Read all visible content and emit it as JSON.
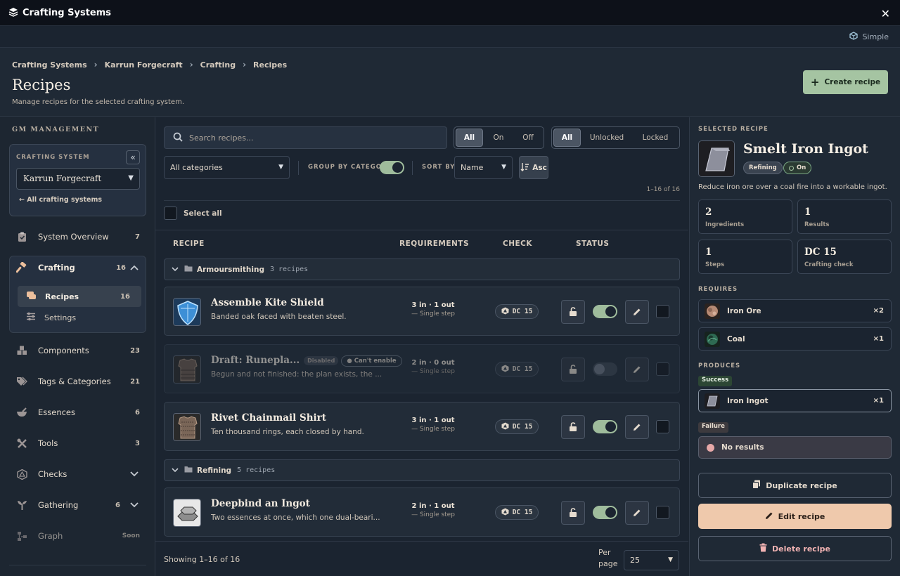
{
  "window": {
    "title": "Crafting Systems",
    "close_label": "✕",
    "mode_label": "Simple"
  },
  "breadcrumb": [
    "Crafting Systems",
    "Karrun Forgecraft",
    "Crafting",
    "Recipes"
  ],
  "page": {
    "title": "Recipes",
    "subtitle": "Manage recipes for the selected crafting system.",
    "create_label": "Create recipe"
  },
  "sidebar": {
    "heading": "GM MANAGEMENT",
    "system_label": "CRAFTING SYSTEM",
    "system_value": "Karrun Forgecraft",
    "back_label": "All crafting systems",
    "items": [
      {
        "label": "System Overview",
        "count": "7"
      },
      {
        "label": "Crafting",
        "count": "16"
      },
      {
        "label": "Components",
        "count": "23"
      },
      {
        "label": "Tags & Categories",
        "count": "21"
      },
      {
        "label": "Essences",
        "count": "6"
      },
      {
        "label": "Tools",
        "count": "3"
      },
      {
        "label": "Checks",
        "count": ""
      },
      {
        "label": "Gathering",
        "count": "6"
      },
      {
        "label": "Graph",
        "count": "Soon"
      }
    ],
    "subitems": [
      {
        "label": "Recipes",
        "count": "16"
      },
      {
        "label": "Settings",
        "count": ""
      }
    ]
  },
  "filters": {
    "search_placeholder": "Search recipes...",
    "state_options": [
      "All",
      "On",
      "Off"
    ],
    "lock_options": [
      "All",
      "Unlocked",
      "Locked"
    ],
    "category_value": "All categories",
    "group_label": "GROUP BY CATEGORY",
    "sort_label": "SORT BY",
    "sort_value": "Name",
    "order_label": "Asc",
    "range_text": "1–16 of 16",
    "select_all": "Select all"
  },
  "table": {
    "headers": [
      "RECIPE",
      "REQUIREMENTS",
      "CHECK",
      "STATUS"
    ],
    "groups": [
      {
        "name": "Armoursmithing",
        "count": "3 recipes"
      },
      {
        "name": "Refining",
        "count": "5 recipes"
      }
    ],
    "rows": [
      {
        "name": "Assemble Kite Shield",
        "desc": "Banded oak faced with beaten steel.",
        "req": "3 in  ·  1 out",
        "steps": "Single step",
        "dc": "DC 15"
      },
      {
        "name": "Draft: Runepla...",
        "badge": "Disabled",
        "badge2": "Can't enable",
        "desc": "Begun and not finished: the plan exists, the ...",
        "req": "2 in  ·  0 out",
        "steps": "Single step",
        "dc": "DC 15"
      },
      {
        "name": "Rivet Chainmail Shirt",
        "desc": "Ten thousand rings, each closed by hand.",
        "req": "3 in  ·  1 out",
        "steps": "Single step",
        "dc": "DC 15"
      },
      {
        "name": "Deepbind an Ingot",
        "desc": "Two essences at once, which one dual-beari...",
        "req": "2 in  ·  1 out",
        "steps": "Single step",
        "dc": "DC 15"
      }
    ]
  },
  "footer": {
    "showing": "Showing 1–16 of 16",
    "per_page_label1": "Per",
    "per_page_label2": "page",
    "per_page_value": "25"
  },
  "detail": {
    "heading": "SELECTED RECIPE",
    "name": "Smelt Iron Ingot",
    "category": "Refining",
    "state": "On",
    "desc": "Reduce iron ore over a coal fire into a workable ingot.",
    "stats": [
      {
        "value": "2",
        "label": "Ingredients"
      },
      {
        "value": "1",
        "label": "Results"
      },
      {
        "value": "1",
        "label": "Steps"
      },
      {
        "value": "DC 15",
        "label": "Crafting check"
      }
    ],
    "requires_heading": "REQUIRES",
    "requires": [
      {
        "name": "Iron Ore",
        "qty": "×2"
      },
      {
        "name": "Coal",
        "qty": "×1"
      }
    ],
    "produces_heading": "PRODUCES",
    "success_label": "Success",
    "produces": [
      {
        "name": "Iron Ingot",
        "qty": "×1"
      }
    ],
    "failure_label": "Failure",
    "no_results": "No results",
    "duplicate_label": "Duplicate recipe",
    "edit_label": "Edit recipe",
    "delete_label": "Delete recipe"
  }
}
